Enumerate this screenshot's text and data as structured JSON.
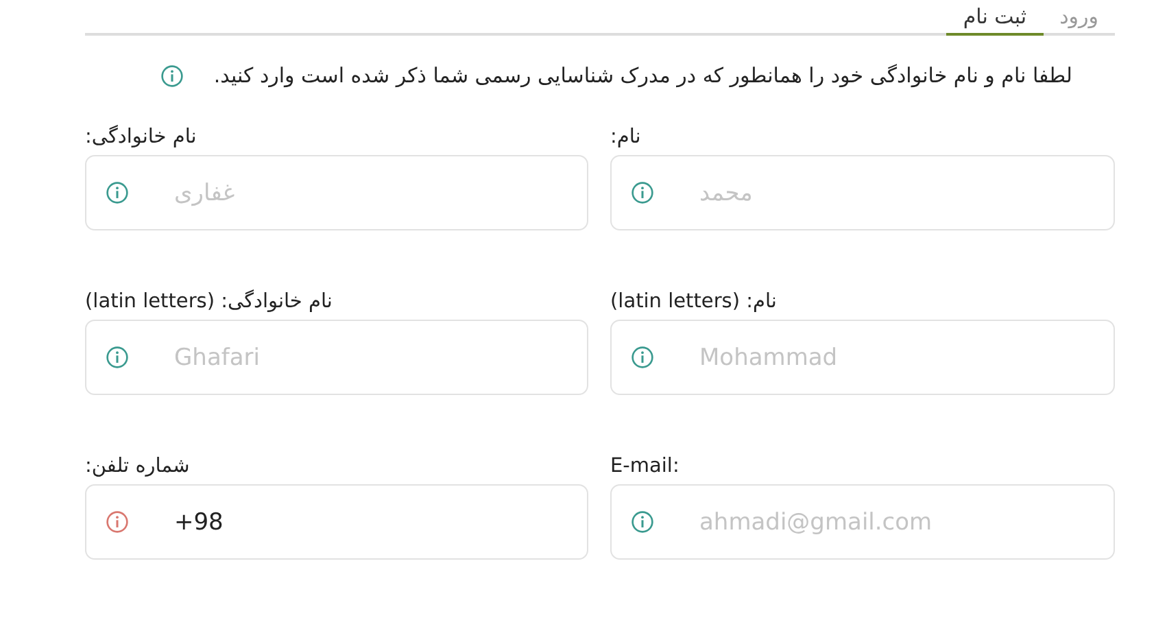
{
  "tabs": [
    {
      "label": "ورود",
      "selected": false
    },
    {
      "label": "ثبت نام",
      "selected": true
    }
  ],
  "notice": "لطفا نام و نام خانوادگی خود را همانطور که در مدرک شناسایی رسمی شما ذکر شده است وارد کنید.",
  "fields": [
    {
      "label": "نام:",
      "placeholder": "محمد",
      "invalid": false
    },
    {
      "label": "نام خانوادگی:",
      "placeholder": "غفاری",
      "invalid": false
    },
    {
      "label": "نام: (latin letters)",
      "placeholder": "Mohammad",
      "invalid": false
    },
    {
      "label": "نام خانوادگی: (latin letters)",
      "placeholder": "Ghafari",
      "invalid": false
    },
    {
      "label": "E-mail:",
      "placeholder": "ahmadi@gmail.com",
      "invalid": false
    },
    {
      "label": "شماره تلفن:",
      "value": "+98",
      "invalid": true
    }
  ]
}
